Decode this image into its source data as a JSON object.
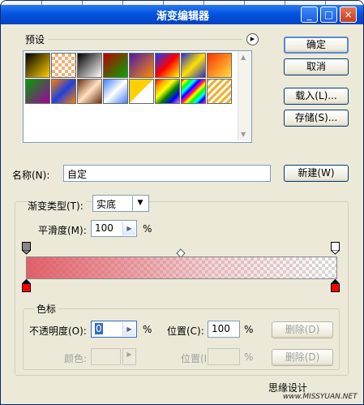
{
  "window": {
    "title": "渐变编辑器"
  },
  "titlebar_buttons": {
    "minimize": "_",
    "maximize": "□",
    "close": "×"
  },
  "presets": {
    "label": "预设",
    "swatches": [
      "linear-gradient(135deg,#000,#ffd000)",
      "repeating-conic-gradient(#f0b070 0 25%,#fff 0 50%) 0 0/8px 8px",
      "linear-gradient(135deg,#000,#fff)",
      "linear-gradient(135deg,#b00,#0a0)",
      "linear-gradient(135deg,#4b1aa8,#ff8a00)",
      "linear-gradient(135deg,#1040ff,#ff0000,#ffff00)",
      "linear-gradient(135deg,#2030d0,#ffe000,#2030d0)",
      "linear-gradient(135deg,#ff3000,#ffe040)",
      "linear-gradient(135deg,#00a000,#a000a0)",
      "linear-gradient(135deg,#ff8000,#2040e0,#ff8000)",
      "linear-gradient(135deg,#6a3010,#ffe0c0,#6a3010)",
      "linear-gradient(135deg,#4080ff,#fff,#4080ff)",
      "linear-gradient(135deg,#ffd000 50%,#fff 50%)",
      "linear-gradient(135deg,red,orange,yellow,green,blue,violet)",
      "repeating-linear-gradient(135deg,red 0,yellow 4px,lime 8px,cyan 12px,blue 16px,magenta 20px)",
      "repeating-linear-gradient(135deg,#f0b030 0 3px,#fff 3px 6px)"
    ]
  },
  "buttons": {
    "ok": "确定",
    "cancel": "取消",
    "load": "载入(L)...",
    "save": "存储(S)...",
    "new": "新建(W)",
    "delete_opacity": "删除(D)",
    "delete_color": "删除(D)"
  },
  "name": {
    "label": "名称(N):",
    "value": "自定"
  },
  "gradient": {
    "type_label": "渐变类型(T):",
    "type_value": "实底",
    "smooth_label": "平滑度(M):",
    "smooth_value": "100",
    "smooth_unit": "%"
  },
  "stops": {
    "group_label": "色标",
    "opacity_label": "不透明度(O):",
    "opacity_value": "0",
    "opacity_unit": "%",
    "location_label": "位置(C):",
    "location_value": "100",
    "location_unit": "%",
    "color_label": "颜色:",
    "color_location_label": "位置(I):",
    "color_location_unit": "%"
  },
  "colors": {
    "start_stop": "#ff0000",
    "end_stop": "#ff0000",
    "accent": "#0454e0"
  },
  "watermark": {
    "cn": "思缘设计",
    "en": "www.MISSYUAN.NET"
  }
}
